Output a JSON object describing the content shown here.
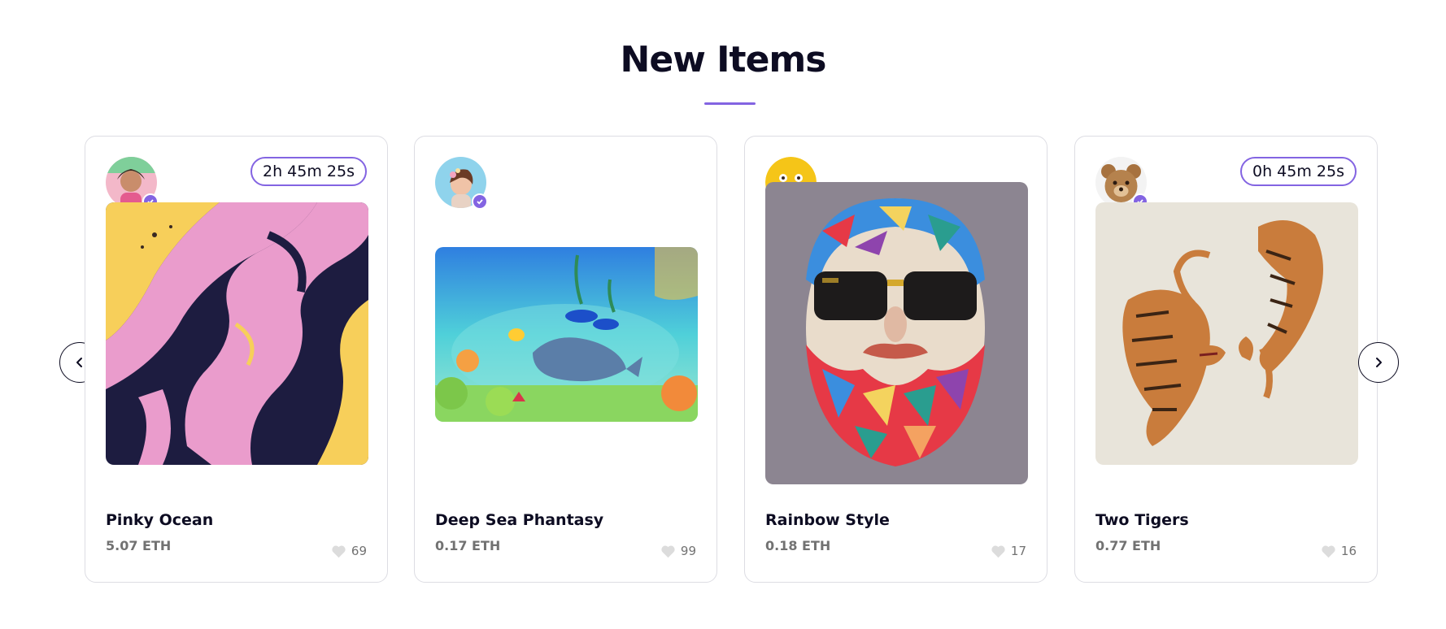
{
  "section": {
    "title": "New Items"
  },
  "nav": {
    "prev": "‹",
    "next": "›"
  },
  "items": [
    {
      "title": "Pinky Ocean",
      "price": "5.07 ETH",
      "likes": "69",
      "timer": "2h 45m 25s"
    },
    {
      "title": "Deep Sea Phantasy",
      "price": "0.17 ETH",
      "likes": "99",
      "timer": ""
    },
    {
      "title": "Rainbow Style",
      "price": "0.18 ETH",
      "likes": "17",
      "timer": ""
    },
    {
      "title": "Two Tigers",
      "price": "0.77 ETH",
      "likes": "16",
      "timer": "0h 45m 25s"
    }
  ],
  "colors": {
    "accent": "#8364e2",
    "heading": "#0d0c22",
    "muted": "#727272",
    "border": "#dddde3"
  }
}
